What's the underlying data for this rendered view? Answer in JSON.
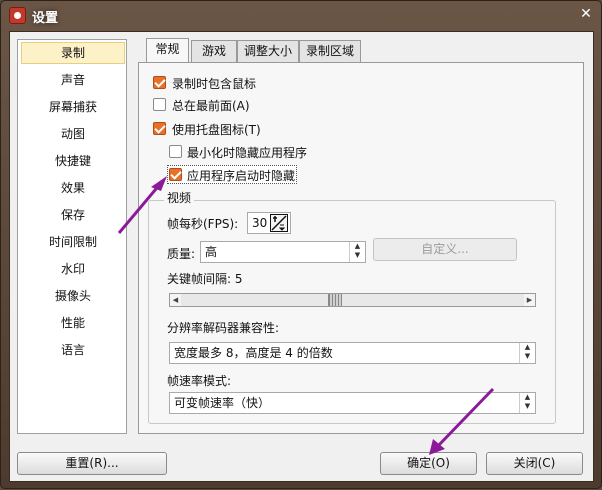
{
  "window": {
    "title": "设置",
    "close_glyph": "✕"
  },
  "sidebar": {
    "items": [
      {
        "label": "录制",
        "selected": true
      },
      {
        "label": "声音"
      },
      {
        "label": "屏幕捕获"
      },
      {
        "label": "动图"
      },
      {
        "label": "快捷键"
      },
      {
        "label": "效果"
      },
      {
        "label": "保存"
      },
      {
        "label": "时间限制"
      },
      {
        "label": "水印"
      },
      {
        "label": "摄像头"
      },
      {
        "label": "性能"
      },
      {
        "label": "语言"
      }
    ]
  },
  "tabs": [
    {
      "label": "常规",
      "active": true
    },
    {
      "label": "游戏"
    },
    {
      "label": "调整大小"
    },
    {
      "label": "录制区域"
    }
  ],
  "general": {
    "options": [
      {
        "label": "录制时包含鼠标",
        "checked": true
      },
      {
        "label": "总在最前面(A)",
        "checked": false
      },
      {
        "label": "使用托盘图标(T)",
        "checked": true
      },
      {
        "label": "最小化时隐藏应用程序",
        "checked": false
      },
      {
        "label": "应用程序启动时隐藏",
        "checked": true
      }
    ]
  },
  "video": {
    "group_title": "视频",
    "fps_label": "帧每秒(FPS):",
    "fps_value": "30",
    "quality_label": "质量:",
    "quality_value": "高",
    "custom_button": "自定义...",
    "keyframe_label": "关键帧间隔: 5",
    "keyframe_value": 5,
    "resolution_label": "分辨率解码器兼容性:",
    "resolution_value": "宽度最多 8，高度是 4 的倍数",
    "framerate_label": "帧速率模式:",
    "framerate_value": "可变帧速率（快）"
  },
  "footer": {
    "reset_label": "重置(R)...",
    "ok_label": "确定(O)",
    "close_label": "关闭(C)"
  },
  "colors": {
    "checkbox_checked": "#e8702a",
    "annotation_arrow": "#8b1a9a",
    "frame": "#5b4a3d"
  }
}
